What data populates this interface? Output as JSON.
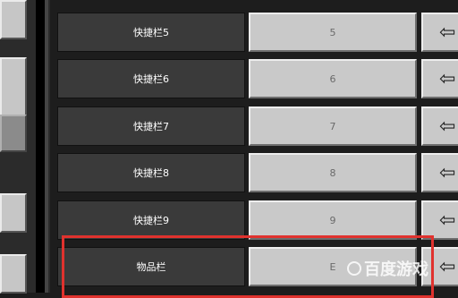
{
  "rows": [
    {
      "label": "快捷栏5",
      "key": "5"
    },
    {
      "label": "快捷栏6",
      "key": "6"
    },
    {
      "label": "快捷栏7",
      "key": "7"
    },
    {
      "label": "快捷栏8",
      "key": "8"
    },
    {
      "label": "快捷栏9",
      "key": "9"
    },
    {
      "label": "物品栏",
      "key": "E"
    }
  ],
  "reset_icon": "arrow-left-icon",
  "reset_glyph": "⇦",
  "highlight_color": "#e0322e",
  "watermark": "百度游戏"
}
